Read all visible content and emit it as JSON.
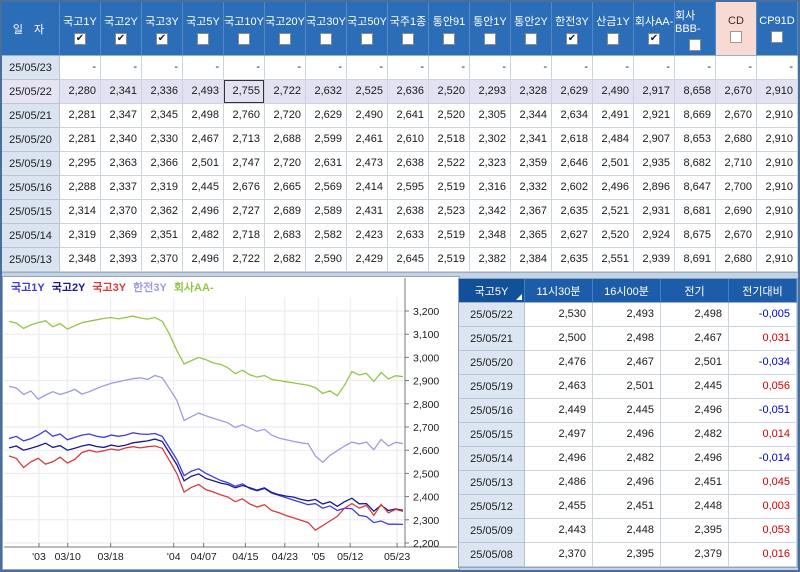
{
  "colors": {
    "header_blue": "#2b6db7",
    "quote_header_blue": "#1c5ca8",
    "cd_highlight_pink": "#f8dad4",
    "selected_row": "#e3e2f2",
    "date_column_bg": "#d9e4f0",
    "negative_value": "#0000cc",
    "positive_value": "#cc0000"
  },
  "top_table": {
    "date_header": "일 자",
    "columns": [
      {
        "label": "국고1Y",
        "checked": true,
        "highlight": false
      },
      {
        "label": "국고2Y",
        "checked": true,
        "highlight": false
      },
      {
        "label": "국고3Y",
        "checked": true,
        "highlight": false
      },
      {
        "label": "국고5Y",
        "checked": false,
        "highlight": false
      },
      {
        "label": "국고10Y",
        "checked": false,
        "highlight": false
      },
      {
        "label": "국고20Y",
        "checked": false,
        "highlight": false
      },
      {
        "label": "국고30Y",
        "checked": false,
        "highlight": false
      },
      {
        "label": "국고50Y",
        "checked": false,
        "highlight": false
      },
      {
        "label": "국주1종",
        "checked": false,
        "highlight": false
      },
      {
        "label": "통안91",
        "checked": false,
        "highlight": false
      },
      {
        "label": "통안1Y",
        "checked": false,
        "highlight": false
      },
      {
        "label": "통안2Y",
        "checked": false,
        "highlight": false
      },
      {
        "label": "한전3Y",
        "checked": true,
        "highlight": false
      },
      {
        "label": "산금1Y",
        "checked": false,
        "highlight": false
      },
      {
        "label": "회사AA-",
        "checked": true,
        "highlight": false
      },
      {
        "label": "회사BBB-",
        "checked": false,
        "highlight": false
      },
      {
        "label": "CD",
        "checked": false,
        "highlight": true
      },
      {
        "label": "CP91D",
        "checked": false,
        "highlight": false
      }
    ],
    "rows": [
      {
        "date": "25/05/23",
        "selected": false,
        "values": [
          "-",
          "-",
          "-",
          "-",
          "-",
          "-",
          "-",
          "-",
          "-",
          "-",
          "-",
          "-",
          "-",
          "-",
          "-",
          "-",
          "-",
          "-"
        ]
      },
      {
        "date": "25/05/22",
        "selected": true,
        "values": [
          "2,280",
          "2,341",
          "2,336",
          "2,493",
          "2,755",
          "2,722",
          "2,632",
          "2,525",
          "2,636",
          "2,520",
          "2,293",
          "2,328",
          "2,629",
          "2,490",
          "2,917",
          "8,658",
          "2,670",
          "2,910"
        ]
      },
      {
        "date": "25/05/21",
        "selected": false,
        "values": [
          "2,281",
          "2,347",
          "2,345",
          "2,498",
          "2,760",
          "2,720",
          "2,629",
          "2,490",
          "2,641",
          "2,520",
          "2,305",
          "2,344",
          "2,634",
          "2,491",
          "2,921",
          "8,669",
          "2,670",
          "2,910"
        ]
      },
      {
        "date": "25/05/20",
        "selected": false,
        "values": [
          "2,281",
          "2,340",
          "2,330",
          "2,467",
          "2,713",
          "2,688",
          "2,599",
          "2,461",
          "2,610",
          "2,518",
          "2,302",
          "2,341",
          "2,618",
          "2,484",
          "2,907",
          "8,653",
          "2,680",
          "2,910"
        ]
      },
      {
        "date": "25/05/19",
        "selected": false,
        "values": [
          "2,295",
          "2,363",
          "2,366",
          "2,501",
          "2,747",
          "2,720",
          "2,631",
          "2,473",
          "2,638",
          "2,522",
          "2,323",
          "2,359",
          "2,646",
          "2,501",
          "2,935",
          "8,682",
          "2,710",
          "2,910"
        ]
      },
      {
        "date": "25/05/16",
        "selected": false,
        "values": [
          "2,288",
          "2,337",
          "2,319",
          "2,445",
          "2,676",
          "2,665",
          "2,569",
          "2,414",
          "2,595",
          "2,519",
          "2,316",
          "2,332",
          "2,602",
          "2,496",
          "2,896",
          "8,647",
          "2,700",
          "2,910"
        ]
      },
      {
        "date": "25/05/15",
        "selected": false,
        "values": [
          "2,314",
          "2,370",
          "2,362",
          "2,496",
          "2,727",
          "2,689",
          "2,589",
          "2,431",
          "2,638",
          "2,523",
          "2,342",
          "2,367",
          "2,635",
          "2,521",
          "2,931",
          "8,681",
          "2,690",
          "2,910"
        ]
      },
      {
        "date": "25/05/14",
        "selected": false,
        "values": [
          "2,319",
          "2,369",
          "2,351",
          "2,482",
          "2,718",
          "2,683",
          "2,582",
          "2,423",
          "2,633",
          "2,519",
          "2,348",
          "2,365",
          "2,627",
          "2,520",
          "2,924",
          "8,675",
          "2,670",
          "2,910"
        ]
      },
      {
        "date": "25/05/13",
        "selected": false,
        "values": [
          "2,348",
          "2,393",
          "2,370",
          "2,496",
          "2,722",
          "2,682",
          "2,590",
          "2,429",
          "2,645",
          "2,519",
          "2,382",
          "2,384",
          "2,635",
          "2,551",
          "2,939",
          "8,691",
          "2,680",
          "2,910"
        ]
      }
    ],
    "focused_cell": {
      "row": 1,
      "col": 4
    }
  },
  "chart_data": {
    "type": "line",
    "title": "",
    "xlabel": "",
    "ylabel": "",
    "ylim": [
      2.2,
      3.2
    ],
    "grid": true,
    "legend_position": "top-left",
    "y_ticks": [
      {
        "value": 3.2,
        "label": "3,200"
      },
      {
        "value": 3.1,
        "label": "3,100"
      },
      {
        "value": 3.0,
        "label": "3,000"
      },
      {
        "value": 2.9,
        "label": "2,900"
      },
      {
        "value": 2.8,
        "label": "2,800"
      },
      {
        "value": 2.7,
        "label": "2,700"
      },
      {
        "value": 2.6,
        "label": "2,600"
      },
      {
        "value": 2.5,
        "label": "2,500"
      },
      {
        "value": 2.4,
        "label": "2,400"
      },
      {
        "value": 2.3,
        "label": "2,300"
      },
      {
        "value": 2.2,
        "label": "2,200"
      }
    ],
    "x_ticks": [
      {
        "label": "'03",
        "pos": 0.076
      },
      {
        "label": "03/10",
        "pos": 0.149
      },
      {
        "label": "03/18",
        "pos": 0.258
      },
      {
        "label": "'04",
        "pos": 0.418
      },
      {
        "label": "04/07",
        "pos": 0.494
      },
      {
        "label": "04/15",
        "pos": 0.6
      },
      {
        "label": "04/23",
        "pos": 0.7
      },
      {
        "label": "'05",
        "pos": 0.785
      },
      {
        "label": "05/12",
        "pos": 0.866
      },
      {
        "label": "05/23",
        "pos": 0.985
      }
    ],
    "x": [
      "03/04",
      "03/05",
      "03/06",
      "03/07",
      "03/10",
      "03/11",
      "03/12",
      "03/13",
      "03/14",
      "03/17",
      "03/18",
      "03/19",
      "03/20",
      "03/21",
      "03/24",
      "03/25",
      "03/26",
      "03/27",
      "03/28",
      "03/31",
      "04/01",
      "04/02",
      "04/03",
      "04/04",
      "04/07",
      "04/08",
      "04/09",
      "04/10",
      "04/11",
      "04/14",
      "04/15",
      "04/16",
      "04/17",
      "04/18",
      "04/21",
      "04/22",
      "04/23",
      "04/24",
      "04/25",
      "04/28",
      "04/29",
      "04/30",
      "05/02",
      "05/07",
      "05/08",
      "05/09",
      "05/12",
      "05/13",
      "05/14",
      "05/15",
      "05/16",
      "05/19",
      "05/20",
      "05/21",
      "05/22"
    ],
    "series": [
      {
        "name": "회사AA-",
        "color": "#90c846",
        "values": [
          3.155,
          3.148,
          3.125,
          3.14,
          3.15,
          3.158,
          3.132,
          3.146,
          3.122,
          3.136,
          3.15,
          3.156,
          3.162,
          3.168,
          3.172,
          3.166,
          3.172,
          3.178,
          3.17,
          3.165,
          3.172,
          3.156,
          3.1,
          3.03,
          2.972,
          2.986,
          3.0,
          2.99,
          2.976,
          2.97,
          2.955,
          2.93,
          2.945,
          2.925,
          2.915,
          2.922,
          2.905,
          2.9,
          2.895,
          2.89,
          2.885,
          2.88,
          2.87,
          2.845,
          2.856,
          2.835,
          2.88,
          2.939,
          2.924,
          2.931,
          2.896,
          2.935,
          2.907,
          2.921,
          2.917
        ]
      },
      {
        "name": "한전3Y",
        "color": "#9b9bea",
        "values": [
          2.875,
          2.868,
          2.84,
          2.855,
          2.82,
          2.838,
          2.852,
          2.84,
          2.85,
          2.862,
          2.842,
          2.852,
          2.866,
          2.878,
          2.888,
          2.895,
          2.902,
          2.908,
          2.912,
          2.905,
          2.922,
          2.912,
          2.865,
          2.815,
          2.728,
          2.745,
          2.76,
          2.748,
          2.738,
          2.728,
          2.718,
          2.698,
          2.71,
          2.695,
          2.682,
          2.69,
          2.665,
          2.652,
          2.645,
          2.638,
          2.632,
          2.628,
          2.575,
          2.548,
          2.578,
          2.598,
          2.618,
          2.635,
          2.627,
          2.635,
          2.602,
          2.646,
          2.618,
          2.634,
          2.629
        ]
      },
      {
        "name": "국고1Y",
        "color": "#3c3ce0",
        "values": [
          2.65,
          2.66,
          2.64,
          2.65,
          2.665,
          2.685,
          2.66,
          2.67,
          2.645,
          2.655,
          2.665,
          2.67,
          2.66,
          2.655,
          2.665,
          2.66,
          2.665,
          2.675,
          2.67,
          2.668,
          2.672,
          2.66,
          2.61,
          2.56,
          2.49,
          2.51,
          2.52,
          2.5,
          2.485,
          2.47,
          2.46,
          2.445,
          2.455,
          2.435,
          2.425,
          2.435,
          2.415,
          2.405,
          2.395,
          2.385,
          2.375,
          2.365,
          2.37,
          2.35,
          2.36,
          2.34,
          2.35,
          2.348,
          2.319,
          2.314,
          2.288,
          2.295,
          2.281,
          2.281,
          2.28
        ]
      },
      {
        "name": "국고2Y",
        "color": "#1a1a8f",
        "values": [
          2.61,
          2.618,
          2.6,
          2.608,
          2.618,
          2.63,
          2.612,
          2.62,
          2.6,
          2.608,
          2.618,
          2.624,
          2.616,
          2.612,
          2.622,
          2.616,
          2.622,
          2.632,
          2.636,
          2.64,
          2.648,
          2.638,
          2.588,
          2.538,
          2.468,
          2.488,
          2.498,
          2.478,
          2.468,
          2.458,
          2.452,
          2.438,
          2.448,
          2.438,
          2.428,
          2.438,
          2.418,
          2.408,
          2.402,
          2.398,
          2.388,
          2.382,
          2.388,
          2.368,
          2.378,
          2.358,
          2.378,
          2.393,
          2.369,
          2.37,
          2.337,
          2.363,
          2.34,
          2.347,
          2.341
        ]
      },
      {
        "name": "국고3Y",
        "color": "#d73c3c",
        "values": [
          2.575,
          2.565,
          2.525,
          2.55,
          2.565,
          2.54,
          2.55,
          2.57,
          2.545,
          2.56,
          2.59,
          2.6,
          2.592,
          2.598,
          2.605,
          2.6,
          2.61,
          2.615,
          2.61,
          2.615,
          2.618,
          2.608,
          2.555,
          2.5,
          2.42,
          2.44,
          2.452,
          2.43,
          2.42,
          2.408,
          2.398,
          2.378,
          2.39,
          2.368,
          2.355,
          2.365,
          2.34,
          2.33,
          2.318,
          2.308,
          2.298,
          2.288,
          2.255,
          2.275,
          2.295,
          2.315,
          2.35,
          2.37,
          2.351,
          2.362,
          2.319,
          2.366,
          2.33,
          2.345,
          2.336
        ]
      }
    ],
    "legend_order": [
      "국고1Y",
      "국고2Y",
      "국고3Y",
      "한전3Y",
      "회사AA-"
    ]
  },
  "quote_table": {
    "corner_header": "국고5Y",
    "headers": [
      "11시30분",
      "16시00분",
      "전기",
      "전기대비"
    ],
    "rows": [
      {
        "date": "25/05/22",
        "t1130": "2,530",
        "t1600": "2,493",
        "prev": "2,498",
        "change": "-0,005"
      },
      {
        "date": "25/05/21",
        "t1130": "2,500",
        "t1600": "2,498",
        "prev": "2,467",
        "change": "0,031"
      },
      {
        "date": "25/05/20",
        "t1130": "2,476",
        "t1600": "2,467",
        "prev": "2,501",
        "change": "-0,034"
      },
      {
        "date": "25/05/19",
        "t1130": "2,463",
        "t1600": "2,501",
        "prev": "2,445",
        "change": "0,056"
      },
      {
        "date": "25/05/16",
        "t1130": "2,449",
        "t1600": "2,445",
        "prev": "2,496",
        "change": "-0,051"
      },
      {
        "date": "25/05/15",
        "t1130": "2,497",
        "t1600": "2,496",
        "prev": "2,482",
        "change": "0,014"
      },
      {
        "date": "25/05/14",
        "t1130": "2,496",
        "t1600": "2,482",
        "prev": "2,496",
        "change": "-0,014"
      },
      {
        "date": "25/05/13",
        "t1130": "2,486",
        "t1600": "2,496",
        "prev": "2,451",
        "change": "0,045"
      },
      {
        "date": "25/05/12",
        "t1130": "2,455",
        "t1600": "2,451",
        "prev": "2,448",
        "change": "0,003"
      },
      {
        "date": "25/05/09",
        "t1130": "2,443",
        "t1600": "2,448",
        "prev": "2,395",
        "change": "0,053"
      },
      {
        "date": "25/05/08",
        "t1130": "2,370",
        "t1600": "2,395",
        "prev": "2,379",
        "change": "0,016"
      }
    ]
  }
}
